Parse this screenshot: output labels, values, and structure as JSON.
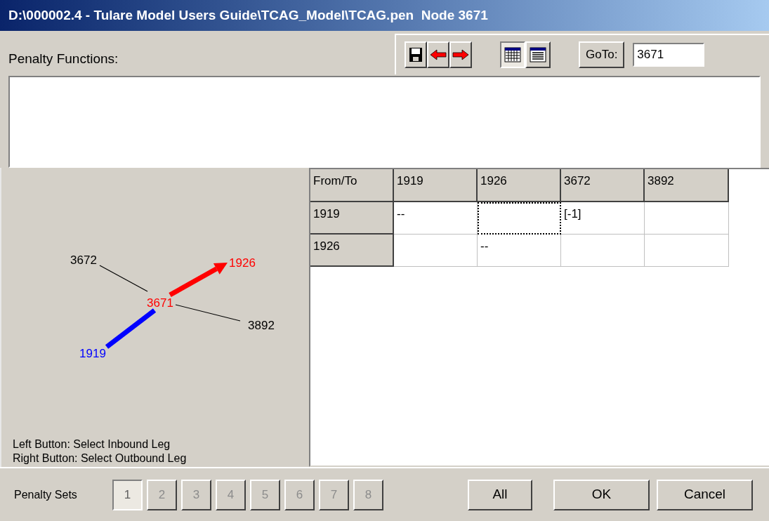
{
  "window": {
    "title": "D:\\000002.4 - Tulare Model Users Guide\\TCAG_Model\\TCAG.pen  Node 3671"
  },
  "penalty_functions": {
    "label": "Penalty Functions:"
  },
  "view_buttons": [
    {
      "kind": "grid",
      "selected": true
    },
    {
      "kind": "list",
      "selected": false
    }
  ],
  "goto": {
    "button": "GoTo:",
    "value": "3671"
  },
  "diagram": {
    "center": {
      "label": "3671",
      "color": "#ff0000"
    },
    "legs": [
      {
        "label": "3672",
        "kind": "plain",
        "color": "#000000"
      },
      {
        "label": "1926",
        "kind": "outbound",
        "color": "#ff0000"
      },
      {
        "label": "3892",
        "kind": "plain",
        "color": "#000000"
      },
      {
        "label": "1919",
        "kind": "inbound",
        "color": "#0000ff"
      }
    ],
    "hints": [
      "Left Button: Select Inbound Leg",
      "Right Button: Select Outbound Leg"
    ]
  },
  "table": {
    "corner": "From/To",
    "columns": [
      "1919",
      "1926",
      "3672",
      "3892"
    ],
    "rows": [
      {
        "header": "1919",
        "cells": [
          {
            "text": "--",
            "selected": false
          },
          {
            "text": "",
            "selected": true
          },
          {
            "text": "[-1]",
            "selected": false
          },
          {
            "text": "",
            "selected": false
          }
        ]
      },
      {
        "header": "1926",
        "cells": [
          {
            "text": "",
            "selected": false
          },
          {
            "text": "--",
            "selected": false
          },
          {
            "text": "",
            "selected": false
          },
          {
            "text": "",
            "selected": false
          }
        ]
      }
    ]
  },
  "penalty_sets": {
    "label": "Penalty Sets",
    "items": [
      {
        "label": "1",
        "selected": true,
        "disabled": false
      },
      {
        "label": "2",
        "selected": false,
        "disabled": true
      },
      {
        "label": "3",
        "selected": false,
        "disabled": true
      },
      {
        "label": "4",
        "selected": false,
        "disabled": true
      },
      {
        "label": "5",
        "selected": false,
        "disabled": true
      },
      {
        "label": "6",
        "selected": false,
        "disabled": true
      },
      {
        "label": "7",
        "selected": false,
        "disabled": true
      },
      {
        "label": "8",
        "selected": false,
        "disabled": true
      }
    ]
  },
  "buttons": [
    "All",
    "OK",
    "Cancel"
  ]
}
